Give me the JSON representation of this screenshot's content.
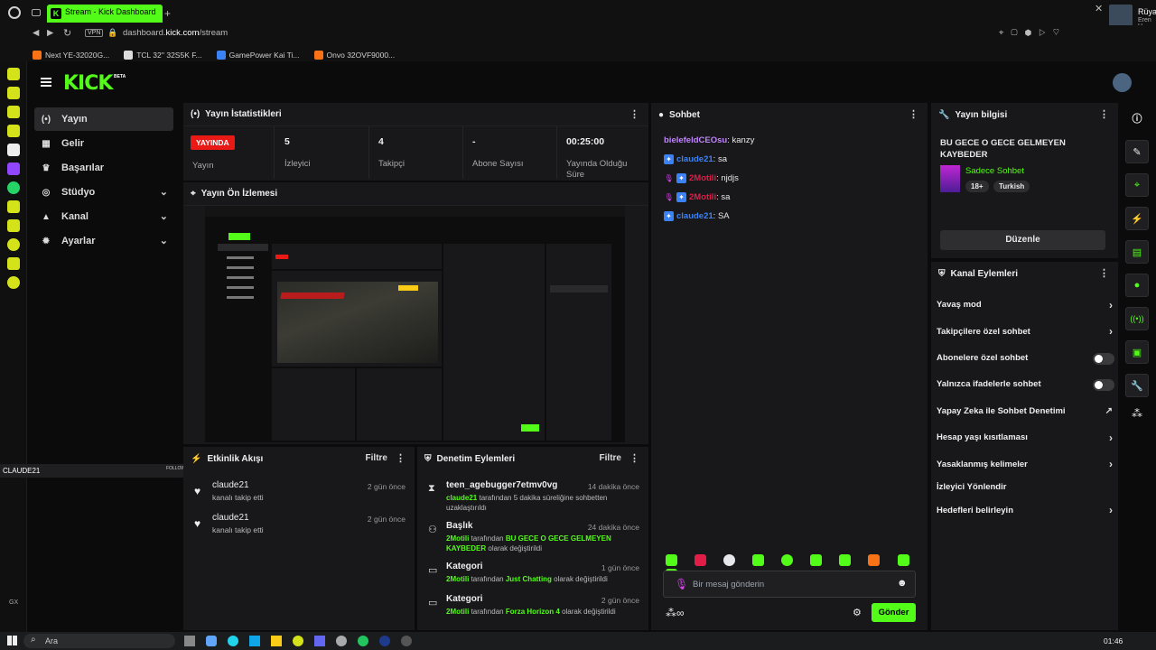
{
  "browser": {
    "tab_title": "Stream - Kick Dashboard",
    "url_prefix": "dashboard.",
    "url_domain": "kick.com",
    "url_path": "/stream",
    "vpn_label": "VPN",
    "bookmarks": [
      "Next YE-32020G...",
      "TCL 32'' 32S5K F...",
      "GamePower Kai Ti...",
      "Onvo 32OVF9000..."
    ],
    "media_title": "Rüya",
    "media_artist": "Eren H"
  },
  "side_widget": {
    "name": "CLAUDE21",
    "action": "FOLLOW"
  },
  "app": {
    "logo": "KICK",
    "logo_beta": "BETA"
  },
  "nav": {
    "items": [
      {
        "label": "Yayın",
        "icon": "(•)"
      },
      {
        "label": "Gelir",
        "icon": "▦"
      },
      {
        "label": "Başarılar",
        "icon": "♛"
      },
      {
        "label": "Stüdyo",
        "icon": "◎"
      },
      {
        "label": "Kanal",
        "icon": "▲"
      },
      {
        "label": "Ayarlar",
        "icon": "✹"
      }
    ]
  },
  "stats": {
    "title": "Yayın İstatistikleri",
    "live_badge": "YAYINDA",
    "live_label": "Yayın",
    "viewers_value": "5",
    "viewers_label": "İzleyici",
    "followers_value": "4",
    "followers_label": "Takipçi",
    "subs_value": "-",
    "subs_label": "Abone Sayısı",
    "uptime_value": "00:25:00",
    "uptime_label_1": "Yayında Olduğu",
    "uptime_label_2": "Süre"
  },
  "preview": {
    "title": "Yayın Ön İzlemesi"
  },
  "activity": {
    "title": "Etkinlik Akışı",
    "filter": "Filtre",
    "items": [
      {
        "name": "claude21",
        "text": "kanalı takip etti",
        "time": "2 gün önce"
      },
      {
        "name": "claude21",
        "text": "kanalı takip etti",
        "time": "2 gün önce"
      }
    ]
  },
  "moderation": {
    "title": "Denetim Eylemleri",
    "filter": "Filtre",
    "items": [
      {
        "title": "teen_agebugger7etmv0vg",
        "time": "14 dakika önce",
        "actor": "claude21",
        "mid": " tarafından 5 dakika süreliğine sohbetten uzaklaştırıldı",
        "value": "",
        "end": ""
      },
      {
        "title": "Başlık",
        "time": "24 dakika önce",
        "actor": "2Motili",
        "mid": " tarafından ",
        "value": "BU GECE O GECE GELMEYEN KAYBEDER",
        "end": " olarak değiştirildi"
      },
      {
        "title": "Kategori",
        "time": "1 gün önce",
        "actor": "2Motili",
        "mid": " tarafından ",
        "value": "Just Chatting",
        "end": " olarak değiştirildi"
      },
      {
        "title": "Kategori",
        "time": "2 gün önce",
        "actor": "2Motili",
        "mid": " tarafından ",
        "value": "Forza Horizon 4",
        "end": " olarak değiştirildi"
      }
    ]
  },
  "chat": {
    "title": "Sohbet",
    "messages": [
      {
        "user": "bielefeldCEOsu",
        "text": "kanzy",
        "color": "#c084fc"
      },
      {
        "user": "claude21",
        "text": "sa",
        "color": "#3b82f6"
      },
      {
        "user": "2Motili",
        "text": "njdjs",
        "color": "#e11d48"
      },
      {
        "user": "2Motili",
        "text": "sa",
        "color": "#e11d48"
      },
      {
        "user": "claude21",
        "text": "SA",
        "color": "#3b82f6"
      }
    ],
    "input_placeholder": "Bir mesaj gönderin",
    "send_label": "Gönder"
  },
  "stream_info": {
    "title": "Yayın bilgisi",
    "stream_title": "BU GECE O GECE GELMEYEN KAYBEDER",
    "category": "Sadece Sohbet",
    "tags": [
      "18+",
      "Turkish"
    ],
    "edit_label": "Düzenle"
  },
  "channel_actions": {
    "title": "Kanal Eylemleri",
    "items": [
      {
        "label": "Yavaş mod",
        "control": "chevron"
      },
      {
        "label": "Takipçilere özel sohbet",
        "control": "chevron"
      },
      {
        "label": "Abonelere özel sohbet",
        "control": "toggle"
      },
      {
        "label": "Yalnızca ifadelerle sohbet",
        "control": "toggle"
      },
      {
        "label": "Yapay Zeka ile Sohbet Denetimi",
        "control": "external"
      },
      {
        "label": "Hesap yaşı kısıtlaması",
        "control": "chevron"
      },
      {
        "label": "Yasaklanmış kelimeler",
        "control": "chevron"
      },
      {
        "label": "İzleyici Yönlendir",
        "control": "none"
      },
      {
        "label": "Hedefleri belirleyin",
        "control": "chevron"
      }
    ]
  },
  "taskbar": {
    "search": "Ara",
    "clock": "01:46"
  },
  "colors": {
    "accent": "#53fc18",
    "live": "#e91916",
    "panel": "#18181b"
  }
}
